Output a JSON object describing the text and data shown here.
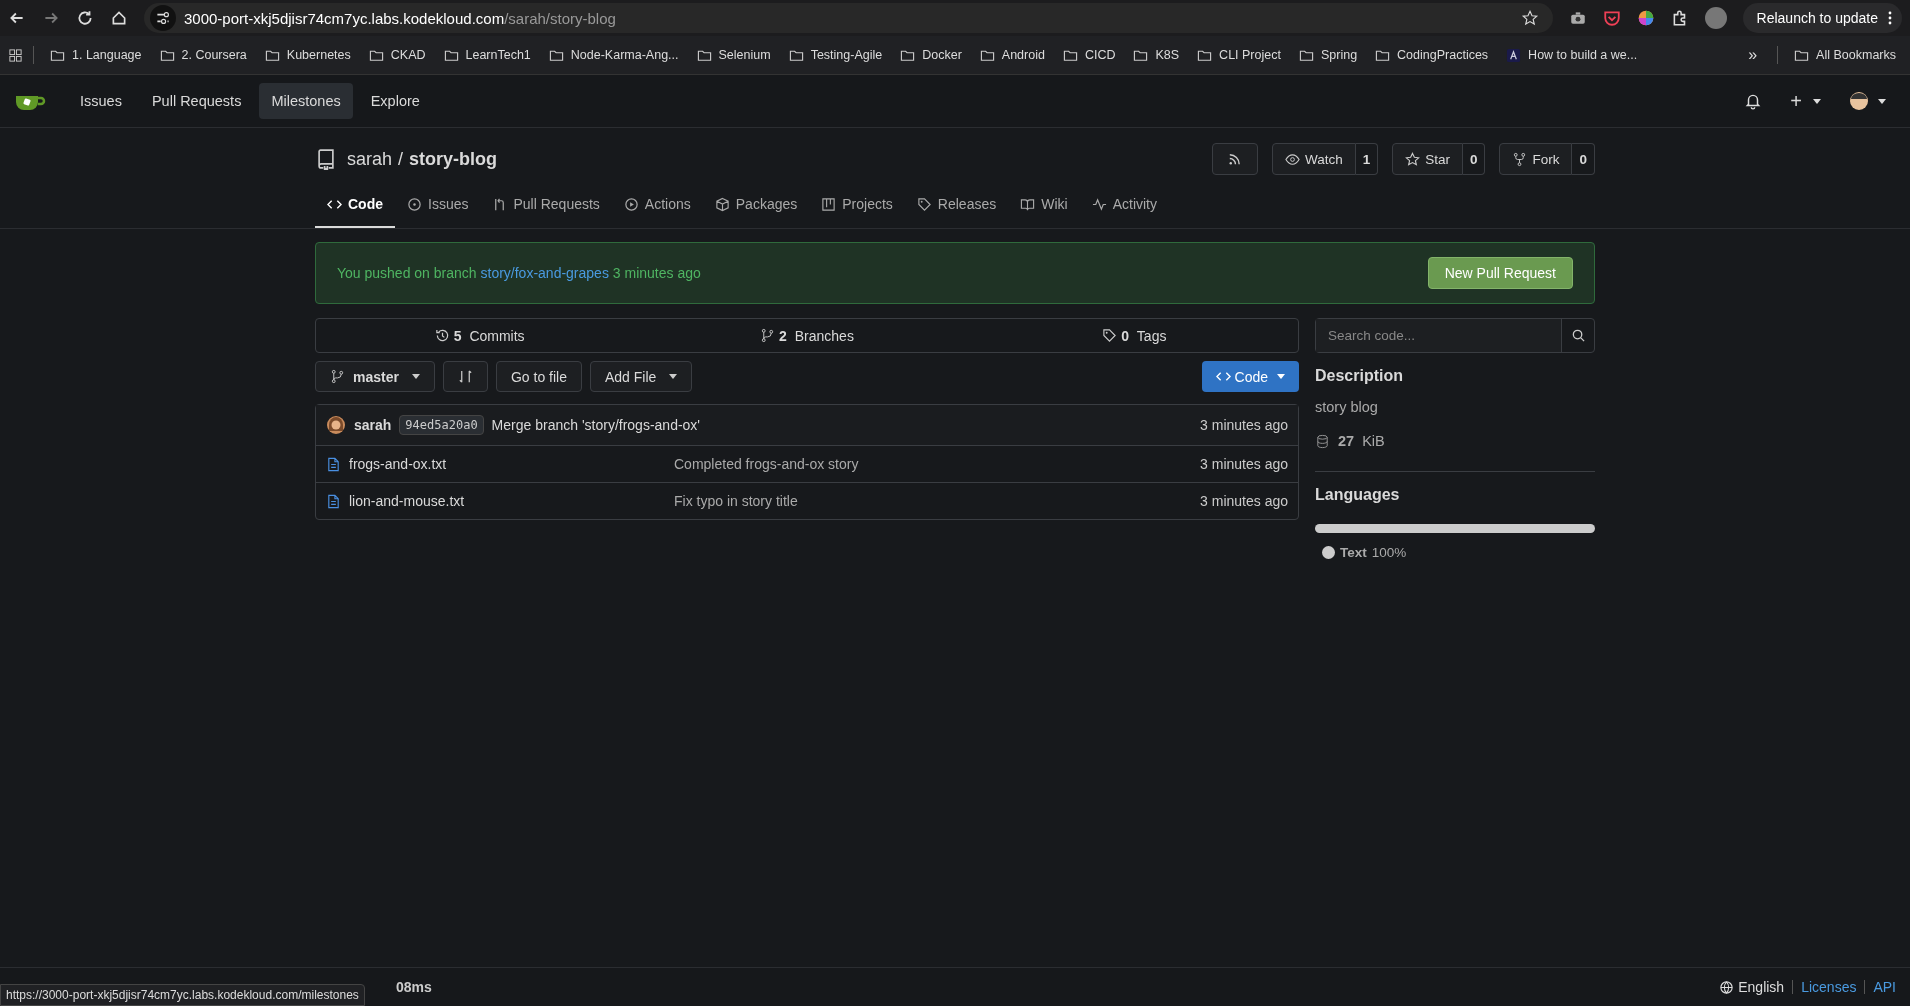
{
  "browser": {
    "url_host": "3000-port-xkj5djisr74cm7yc.labs.kodekloud.com",
    "url_path": "/sarah/story-blog",
    "relaunch": "Relaunch to update",
    "bookmarks": [
      {
        "label": "1. Language",
        "kind": "folder"
      },
      {
        "label": "2. Coursera",
        "kind": "folder"
      },
      {
        "label": "Kubernetes",
        "kind": "folder"
      },
      {
        "label": "CKAD",
        "kind": "folder"
      },
      {
        "label": "LearnTech1",
        "kind": "folder"
      },
      {
        "label": "Node-Karma-Ang...",
        "kind": "folder"
      },
      {
        "label": "Selenium",
        "kind": "folder"
      },
      {
        "label": "Testing-Agile",
        "kind": "folder"
      },
      {
        "label": "Docker",
        "kind": "folder"
      },
      {
        "label": "Android",
        "kind": "folder"
      },
      {
        "label": "CICD",
        "kind": "folder"
      },
      {
        "label": "K8S",
        "kind": "folder"
      },
      {
        "label": "CLI Project",
        "kind": "folder"
      },
      {
        "label": "Spring",
        "kind": "folder"
      },
      {
        "label": "CodingPractices",
        "kind": "folder"
      },
      {
        "label": "How to build a we...",
        "kind": "site"
      }
    ],
    "more": "»",
    "all_bookmarks": "All Bookmarks"
  },
  "nav": {
    "items": [
      {
        "label": "Issues",
        "selected": false
      },
      {
        "label": "Pull Requests",
        "selected": false
      },
      {
        "label": "Milestones",
        "selected": true
      },
      {
        "label": "Explore",
        "selected": false
      }
    ],
    "plus": "+"
  },
  "repo": {
    "owner": "sarah",
    "separator": "/",
    "name": "story-blog",
    "actions": [
      {
        "label": "Watch",
        "count": "1"
      },
      {
        "label": "Star",
        "count": "0"
      },
      {
        "label": "Fork",
        "count": "0"
      }
    ]
  },
  "tabs": [
    {
      "label": "Code",
      "selected": true
    },
    {
      "label": "Issues",
      "selected": false
    },
    {
      "label": "Pull Requests",
      "selected": false
    },
    {
      "label": "Actions",
      "selected": false
    },
    {
      "label": "Packages",
      "selected": false
    },
    {
      "label": "Projects",
      "selected": false
    },
    {
      "label": "Releases",
      "selected": false
    },
    {
      "label": "Wiki",
      "selected": false
    },
    {
      "label": "Activity",
      "selected": false
    }
  ],
  "banner": {
    "prefix": "You pushed on branch",
    "branch": "story/fox-and-grapes",
    "suffix": "3 minutes ago",
    "button": "New Pull Request"
  },
  "stats": [
    {
      "count": "5",
      "label": "Commits"
    },
    {
      "count": "2",
      "label": "Branches"
    },
    {
      "count": "0",
      "label": "Tags"
    }
  ],
  "toolbar": {
    "branch": "master",
    "go_to_file": "Go to file",
    "add_file": "Add File",
    "code": "Code"
  },
  "latest_commit": {
    "author": "sarah",
    "sha": "94ed5a20a0",
    "message": "Merge branch 'story/frogs-and-ox'",
    "time": "3 minutes ago"
  },
  "files": [
    {
      "name": "frogs-and-ox.txt",
      "message": "Completed frogs-and-ox story",
      "time": "3 minutes ago"
    },
    {
      "name": "lion-and-mouse.txt",
      "message": "Fix typo in story title",
      "time": "3 minutes ago"
    }
  ],
  "sidebar": {
    "search_placeholder": "Search code...",
    "description_heading": "Description",
    "description": "story blog",
    "size": "27",
    "size_unit": "KiB",
    "languages_heading": "Languages",
    "languages": [
      {
        "name": "Text",
        "percent": "100%",
        "level": 1
      }
    ]
  },
  "footer": {
    "text": "08ms",
    "language": "English",
    "links": [
      "Licenses",
      "API"
    ],
    "status_url": "https://3000-port-xkj5djisr74cm7yc.labs.kodekloud.com/milestones"
  }
}
